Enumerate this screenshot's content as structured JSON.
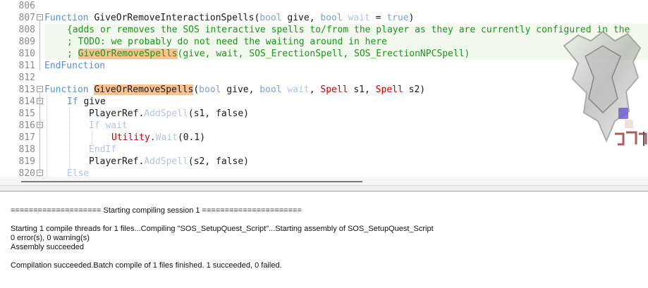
{
  "editor": {
    "line_numbers": [
      "806",
      "807",
      "808",
      "809",
      "810",
      "811",
      "812",
      "813",
      "814",
      "815",
      "816",
      "817",
      "818",
      "819",
      "820"
    ],
    "lines": {
      "l807": {
        "kw": "Function",
        "name": "GiveOrRemoveInteractionSpells",
        "p1": "(",
        "t1": "bool",
        "a1": " give, ",
        "t2": "bool",
        "a2": " wait",
        "a3": " = ",
        "v3": "true",
        "p2": ")"
      },
      "l808": {
        "comment": "{adds or removes the SOS interactive spells to/from the player as they are currently configured in the"
      },
      "l809": {
        "comment": "; TODO: we probably do not need the waiting around in here"
      },
      "l810": {
        "pre": "; ",
        "hl": "GiveOrRemoveSpells",
        "post": "(give, wait, SOS_ErectionSpell, SOS_ErectionNPCSpell)"
      },
      "l811": {
        "kw": "EndFunction"
      },
      "l813": {
        "kw": "Function",
        "hl": "GiveOrRemoveSpells",
        "p1": "(",
        "t1": "bool",
        "a1": " give, ",
        "t2": "bool",
        "a2": " wait",
        "c1": ", ",
        "t3": "Spell",
        "a3": " s1, ",
        "t4": "Spell",
        "a4": " s2",
        "p2": ")"
      },
      "l814": {
        "kw": "If",
        "rest": " give"
      },
      "l815": {
        "obj": "PlayerRef.",
        "fn": "AddSpell",
        "args": "(s1, false)"
      },
      "l816": {
        "kw": "If",
        "rest": " wait"
      },
      "l817": {
        "obj": "Utility.",
        "fn": "Wait",
        "args": "(0.1)"
      },
      "l818": {
        "kw": "EndIf"
      },
      "l819": {
        "obj": "PlayerRef.",
        "fn": "AddSpell",
        "args": "(s2, false)"
      },
      "l820": {
        "kw": "Else"
      }
    }
  },
  "output": {
    "lines": [
      "==================== Starting compiling session 1 ======================",
      "Starting 1 compile threads for 1 files...Compiling \"SOS_SetupQuest_Script\"...Starting assembly of SOS_SetupQuest_Script",
      "0 error(s), 0 warning(s)",
      "Assembly succeeded",
      "Compilation succeeded.Batch compile of 1 files finished. 1 succeeded, 0 failed."
    ]
  },
  "colors": {
    "keyword": "#5b8fd8",
    "comment": "#189818",
    "spell_type": "#cc0000",
    "highlight": "#f8c291"
  },
  "icons": {
    "emblem": "skyrim-dragon-emblem-icon",
    "fold": "fold-toggle-icon"
  }
}
